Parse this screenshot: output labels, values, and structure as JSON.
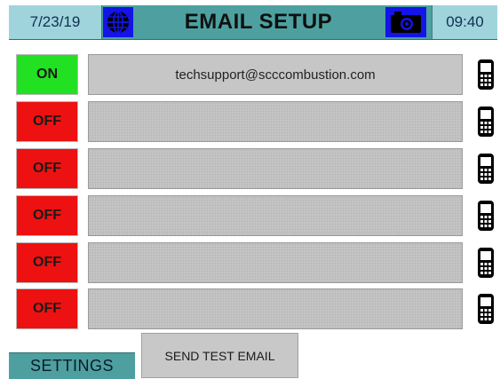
{
  "header": {
    "date": "7/23/19",
    "title": "EMAIL SETUP",
    "time": "09:40"
  },
  "rows": [
    {
      "state": "ON",
      "email": "techsupport@scccombustion.com"
    },
    {
      "state": "OFF",
      "email": ""
    },
    {
      "state": "OFF",
      "email": ""
    },
    {
      "state": "OFF",
      "email": ""
    },
    {
      "state": "OFF",
      "email": ""
    },
    {
      "state": "OFF",
      "email": ""
    }
  ],
  "footer": {
    "settings_label": "SETTINGS",
    "send_test_label": "SEND TEST EMAIL"
  },
  "colors": {
    "header": "#4ea0a0",
    "header_light": "#9fd4dc",
    "icon_bg": "#1414e6",
    "on": "#22e122",
    "off": "#ee1111",
    "field": "#c4c4c4"
  },
  "icons": {
    "globe": "globe-icon",
    "camera": "camera-icon",
    "phone": "mobile-phone-icon"
  }
}
